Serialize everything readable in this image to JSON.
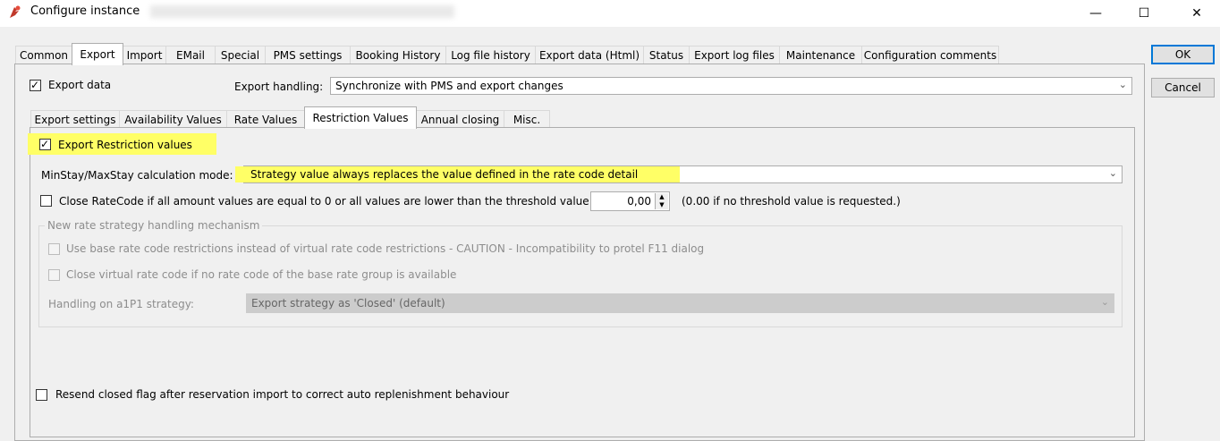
{
  "window": {
    "title": "Configure instance",
    "minimize": "—",
    "maximize": "☐",
    "close": "✕"
  },
  "buttons": {
    "ok": "OK",
    "cancel": "Cancel"
  },
  "main_tabs": [
    "Common",
    "Export",
    "Import",
    "EMail",
    "Special",
    "PMS settings",
    "Booking History",
    "Log file history",
    "Export data (Html)",
    "Status",
    "Export log files",
    "Maintenance",
    "Configuration comments"
  ],
  "export": {
    "export_data_label": "Export data",
    "export_handling_label": "Export handling:",
    "export_handling_value": "Synchronize with PMS and export changes"
  },
  "sub_tabs": [
    "Export settings",
    "Availability Values",
    "Rate Values",
    "Restriction Values",
    "Annual closing",
    "Misc."
  ],
  "restriction": {
    "export_restriction_label": "Export Restriction values",
    "calc_mode_label": "MinStay/MaxStay calculation mode:",
    "calc_mode_value": "Strategy value always replaces the value defined in the rate code detail",
    "close_ratecode_label": "Close RateCode if all amount values are equal to 0 or all values are lower than the threshold value",
    "threshold_value": "0,00",
    "threshold_hint": "(0.00 if no threshold value is requested.)",
    "group_title": "New rate strategy handling mechanism",
    "base_rate_label": "Use base rate code restrictions instead of virtual rate code restrictions - CAUTION - Incompatibility to protel F11 dialog",
    "close_virtual_label": "Close virtual rate code if no rate code of the base rate group is available",
    "a1p1_label": "Handling on a1P1 strategy:",
    "a1p1_value": "Export strategy as 'Closed' (default)",
    "resend_label": "Resend closed flag after reservation import to correct auto replenishment behaviour"
  }
}
